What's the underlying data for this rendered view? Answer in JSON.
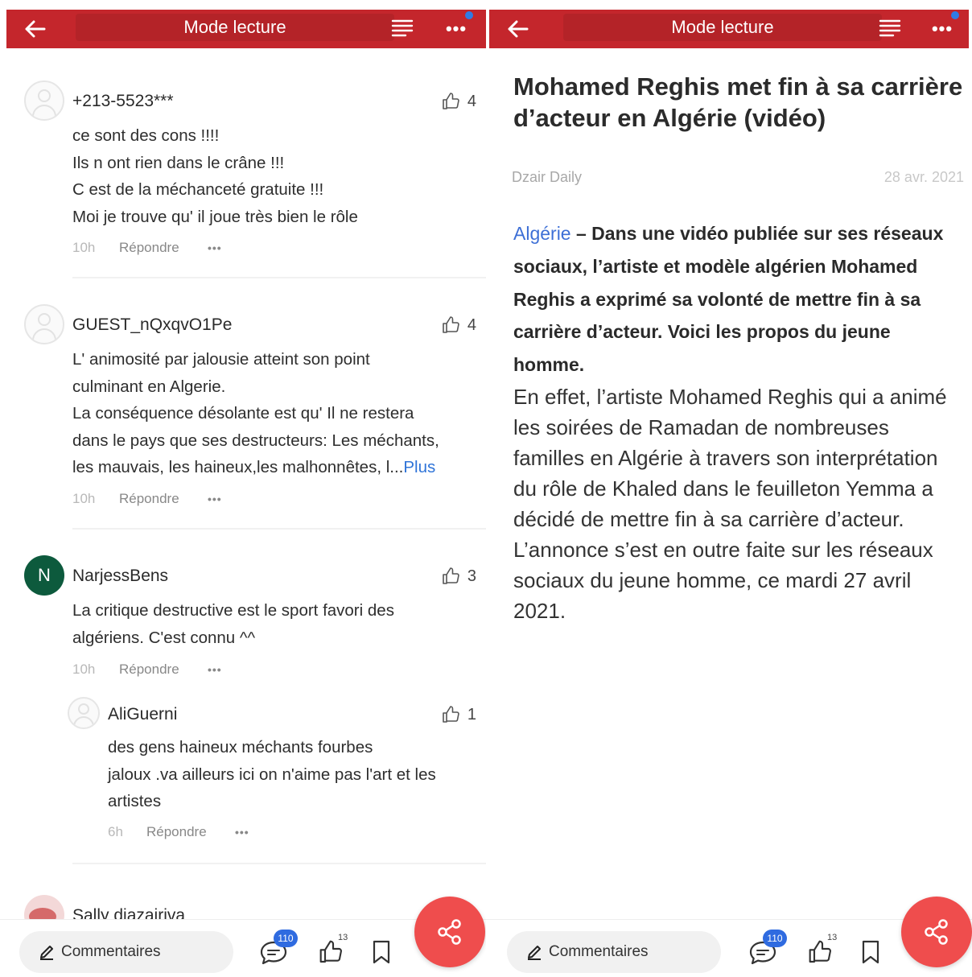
{
  "header": {
    "title": "Mode lecture",
    "more_label": "•••"
  },
  "comments": [
    {
      "author": "+213-5523***",
      "likes": "4",
      "avatar": "user-placeholder",
      "lines": [
        "ce sont des cons !!!!",
        "Ils n ont rien dans le crâne !!!",
        "C est de la méchanceté gratuite !!!",
        "Moi je trouve qu' il joue très bien le rôle"
      ],
      "time": "10h",
      "reply": "Répondre",
      "dots": "•••"
    },
    {
      "author": "GUEST_nQxqvO1Pe",
      "likes": "4",
      "avatar": "user-placeholder",
      "lines": [
        "L' animosité  par jalousie atteint son point",
        "culminant en Algerie.",
        "La conséquence désolante est qu' Il ne restera",
        "dans le pays que ses destructeurs: Les méchants,",
        "les mauvais, les haineux,les malhonnêtes, l..."
      ],
      "more": "Plus",
      "time": "10h",
      "reply": "Répondre",
      "dots": "•••"
    },
    {
      "author": "NarjessBens",
      "likes": "3",
      "avatar_letter": "N",
      "lines": [
        "La critique destructive est le sport favori des",
        "algériens. C'est connu ^^"
      ],
      "time": "10h",
      "reply": "Répondre",
      "dots": "•••"
    },
    {
      "author": "AliGuerni",
      "likes": "1",
      "avatar": "user-placeholder",
      "lines": [
        "des gens haineux méchants fourbes",
        "jaloux .va ailleurs ici on n'aime pas l'art et les",
        "artistes"
      ],
      "time": "6h",
      "reply": "Répondre",
      "dots": "•••"
    },
    {
      "author": "Sally diazairiva"
    }
  ],
  "bottombar": {
    "comment_label": "Commentaires",
    "comment_count": "110",
    "like_count": "13"
  },
  "article": {
    "title": "Mohamed Reghis met fin à sa carrière d’acteur en Algérie (vidéo)",
    "source": "Dzair Daily",
    "date": "28 avr. 2021",
    "lead_place": "Algérie",
    "lead_text": " – Dans une vidéo publiée sur ses réseaux sociaux, l’artiste et modèle algérien Mohamed Reghis a exprimé sa volonté de mettre fin à sa carrière d’acteur. Voici les propos du jeune homme.",
    "body": "En effet, l’artiste Mohamed Reghis qui a animé les soirées de Ramadan de nombreuses familles en Algérie à travers son interprétation du rôle de Khaled dans le feuilleton Yemma a décidé de mettre fin à sa carrière d’acteur. L’annonce s’est en outre faite sur les réseaux sociaux du jeune homme, ce mardi 27 avril 2021."
  },
  "colors": {
    "header": "#c4262c",
    "fab": "#ef4d4d",
    "link": "#2f74d8",
    "badge": "#2f6be0",
    "avatar_n": "#0d5a3d"
  }
}
